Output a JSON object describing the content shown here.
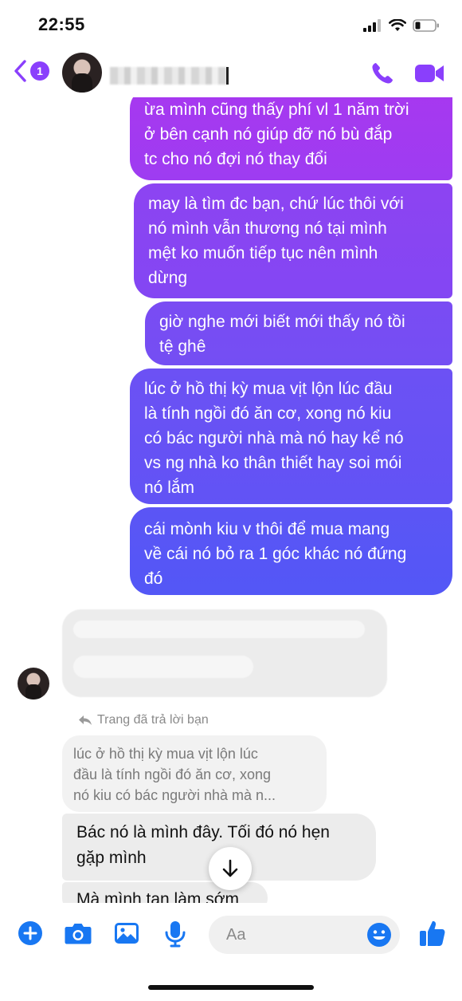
{
  "status_bar": {
    "time": "22:55"
  },
  "header": {
    "back_count": "1"
  },
  "messages_outgoing": [
    {
      "lines": [
        "ừa mình cũng thấy phí vl 1 năm trời",
        "ở bên cạnh nó giúp đỡ nó bù đắp",
        "tc cho nó đợi nó thay đổi"
      ]
    },
    {
      "lines": [
        "may là tìm đc bạn, chứ lúc thôi với",
        "nó mình vẫn thương nó tại mình",
        "mệt ko muốn tiếp tục nên mình",
        "dừng"
      ]
    },
    {
      "lines": [
        "giờ nghe mới biết mới thấy nó tồi",
        "tệ ghê"
      ]
    },
    {
      "lines": [
        "lúc ở hồ thị kỳ mua vịt lộn lúc đầu",
        "là tính ngồi đó ăn cơ, xong nó kiu",
        "có bác người nhà mà nó hay kể nó",
        "vs ng nhà ko thân thiết hay soi mói",
        "nó lắm"
      ]
    },
    {
      "lines": [
        "cái mònh kiu v thôi để mua mang",
        "về cái nó bỏ ra 1 góc khác nó đứng",
        "đó"
      ]
    }
  ],
  "reply": {
    "label": "Trang đã trả lời bạn",
    "quoted_lines": [
      "lúc ở hồ thị kỳ mua vịt lộn lúc",
      "đầu là tính ngồi đó ăn cơ, xong",
      "nó kiu có bác người nhà mà n..."
    ]
  },
  "messages_incoming": [
    {
      "lines": [
        "Bác nó là mình đây. Tối đó nó hẹn",
        "gặp mình"
      ]
    },
    {
      "lines": [
        "Mà mình tan làm sớm"
      ]
    }
  ],
  "composer": {
    "placeholder": "Aa"
  },
  "icons": {
    "back": "chevron-left-icon",
    "phone": "phone-icon",
    "video": "video-camera-icon",
    "plus": "plus-icon",
    "camera": "camera-icon",
    "gallery": "image-icon",
    "mic": "microphone-icon",
    "emoji": "emoji-icon",
    "like": "thumbs-up-icon",
    "scroll": "arrow-down-icon",
    "reply": "reply-arrow-icon"
  },
  "colors": {
    "accent": "#8a3ffc",
    "composer_accent": "#1877f2",
    "incoming_bubble": "#ececec"
  }
}
